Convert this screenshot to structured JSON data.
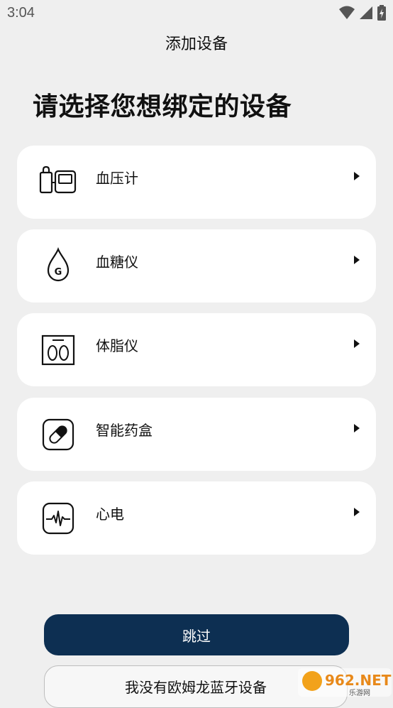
{
  "status_bar": {
    "time": "3:04",
    "icons": [
      "wifi-icon",
      "signal-icon",
      "battery-charging-icon"
    ]
  },
  "header": {
    "title": "添加设备"
  },
  "main": {
    "heading": "请选择您想绑定的设备",
    "devices": [
      {
        "label": "血压计",
        "icon": "blood-pressure-monitor-icon"
      },
      {
        "label": "血糖仪",
        "icon": "blood-glucose-drop-icon"
      },
      {
        "label": "体脂仪",
        "icon": "body-fat-scale-icon"
      },
      {
        "label": "智能药盒",
        "icon": "pill-box-icon"
      },
      {
        "label": "心电",
        "icon": "ecg-icon"
      }
    ]
  },
  "footer": {
    "skip_label": "跳过",
    "no_device_label": "我没有欧姆龙蓝牙设备"
  },
  "watermark": {
    "text": "962.NET",
    "subtext": "乐游网"
  },
  "colors": {
    "primary": "#0d2f52",
    "background": "#efefef",
    "card": "#ffffff"
  }
}
